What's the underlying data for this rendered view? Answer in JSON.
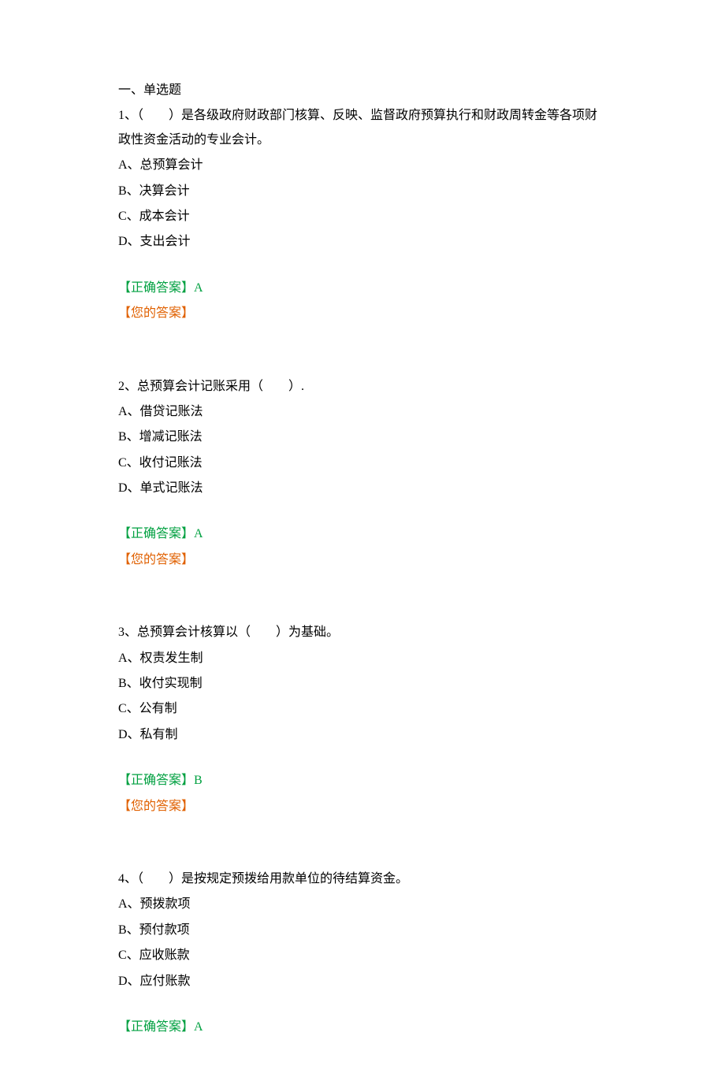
{
  "section_title": "一、单选题",
  "questions": [
    {
      "number": "1、",
      "text": "（　　）是各级政府财政部门核算、反映、监督政府预算执行和财政周转金等各项财政性资金活动的专业会计。",
      "options": [
        "A、总预算会计",
        "B、决算会计",
        "C、成本会计",
        "D、支出会计"
      ],
      "correct_label": "【正确答案】",
      "correct_value": "A",
      "your_label": "【您的答案】"
    },
    {
      "number": "2、",
      "text": "总预算会计记账采用（　　）.",
      "options": [
        "A、借贷记账法",
        "B、增减记账法",
        "C、收付记账法",
        "D、单式记账法"
      ],
      "correct_label": "【正确答案】",
      "correct_value": "A",
      "your_label": "【您的答案】"
    },
    {
      "number": "3、",
      "text": "总预算会计核算以（　　）为基础。",
      "options": [
        "A、权责发生制",
        "B、收付实现制",
        "C、公有制",
        "D、私有制"
      ],
      "correct_label": "【正确答案】",
      "correct_value": "B",
      "your_label": "【您的答案】"
    },
    {
      "number": "4、",
      "text": "（　　）是按规定预拨给用款单位的待结算资金。",
      "options": [
        "A、预拨款项",
        "B、预付款项",
        "C、应收账款",
        "D、应付账款"
      ],
      "correct_label": "【正确答案】",
      "correct_value": "A",
      "your_label": ""
    }
  ]
}
